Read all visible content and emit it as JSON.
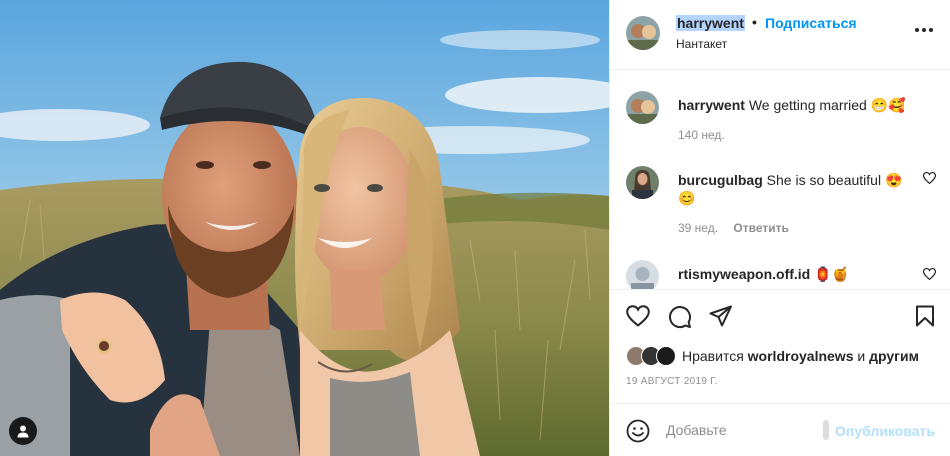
{
  "post": {
    "author": "harrywent",
    "follow_label": "Подписаться",
    "location": "Нантакет",
    "dot": "•"
  },
  "comments": [
    {
      "user": "harrywent",
      "text": "We getting married 😁🥰",
      "age": "140 нед.",
      "reply": ""
    },
    {
      "user": "burcugulbag",
      "text": "She is so beautiful 😍 😊",
      "age": "39 нед.",
      "reply": "Ответить"
    },
    {
      "user": "rtismyweapon.off.id",
      "text": "🏮🍯",
      "age": "",
      "reply": ""
    }
  ],
  "likes": {
    "prefix": "Нравится",
    "user": "worldroyalnews",
    "joiner": "и",
    "suffix": "другим"
  },
  "date": "19 АВГУСТ 2019 Г.",
  "composer": {
    "placeholder": "Добавьте",
    "publish_label": "Опубликовать"
  },
  "icons": {
    "more": "more-horizontal-icon",
    "like": "heart-icon",
    "comment": "comment-icon",
    "share": "send-icon",
    "save": "bookmark-icon",
    "emoji": "smiley-icon",
    "tag": "user-tag-icon"
  },
  "colors": {
    "accent": "#0095f6",
    "publish_disabled": "#b2dffc",
    "muted": "#8e8e8e",
    "text": "#262626",
    "selection": "#b3d4fc"
  }
}
